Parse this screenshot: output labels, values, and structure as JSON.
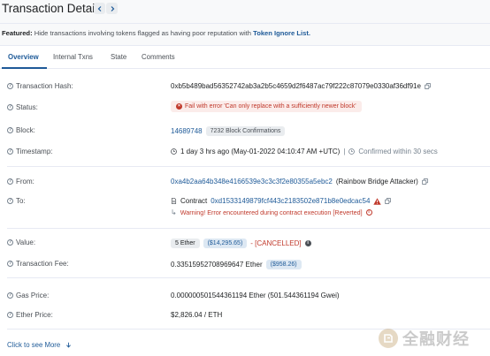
{
  "header": {
    "title": "Transaction Details"
  },
  "featured": {
    "prefix": "Featured:",
    "text": "Hide transactions involving tokens flagged as having poor reputation with",
    "link": "Token Ignore List."
  },
  "tabs": [
    {
      "label": "Overview"
    },
    {
      "label": "Internal Txns"
    },
    {
      "label": "State"
    },
    {
      "label": "Comments"
    }
  ],
  "overview": {
    "tx_hash": {
      "label": "Transaction Hash:",
      "value": "0xb5b489bad56352742ab3a2b5c4659d2f6487ac79f222c87079e0330af36df91e"
    },
    "status": {
      "label": "Status:",
      "value": "Fail with error 'Can only replace with a sufficiently newer block'"
    },
    "block": {
      "label": "Block:",
      "value": "14689748",
      "confirmations": "7232 Block Confirmations"
    },
    "timestamp": {
      "label": "Timestamp:",
      "value": "1 day 3 hrs ago (May-01-2022 04:10:47 AM +UTC)",
      "confirmed": "Confirmed within 30 secs"
    },
    "from": {
      "label": "From:",
      "value": "0xa4b2aa64b348e4166539e3c3c3f2e80355a5ebc2",
      "tag": "(Rainbow Bridge Attacker)"
    },
    "to": {
      "label": "To:",
      "prefix": "Contract",
      "value": "0xd1533149879fcf443c2183502e871b8e0edcac54",
      "warning": "Warning! Error encountered during contract execution [Reverted]"
    },
    "value": {
      "label": "Value:",
      "ether": "5 Ether",
      "usd": "($14,295.65)",
      "cancelled": "- [CANCELLED]"
    },
    "fee": {
      "label": "Transaction Fee:",
      "value": "0.33515952708969647 Ether",
      "usd": "($958.26)"
    },
    "gas_price": {
      "label": "Gas Price:",
      "value": "0.000000501544361194 Ether (501.544361194 Gwei)"
    },
    "ether_price": {
      "label": "Ether Price:",
      "value": "$2,826.04 / ETH"
    }
  },
  "see_more": {
    "label": "Click to see More"
  },
  "watermark": {
    "text": "全融财经"
  },
  "colors": {
    "link": "#1e5a98",
    "error": "#c0392b",
    "text": "#1e2022",
    "muted": "#77838f"
  }
}
